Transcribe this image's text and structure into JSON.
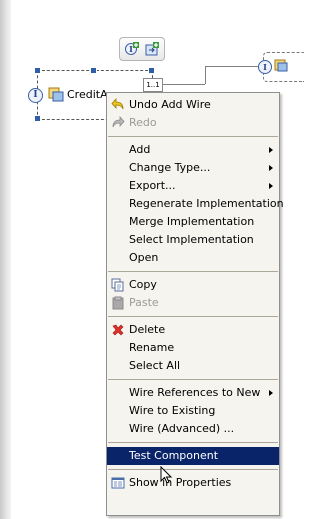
{
  "component": {
    "name": "CreditApproval",
    "label": "CreditAp",
    "interface_symbol": "I",
    "multiplicity": "1..1"
  },
  "target": {
    "interface_symbol": "I"
  },
  "menu": {
    "undo": "Undo Add Wire",
    "redo": "Redo",
    "add": "Add",
    "change_type": "Change Type...",
    "export": "Export...",
    "regenerate": "Regenerate Implementation",
    "merge": "Merge Implementation",
    "select_impl": "Select Implementation",
    "open": "Open",
    "copy": "Copy",
    "paste": "Paste",
    "delete": "Delete",
    "rename": "Rename",
    "select_all": "Select All",
    "wire_refs": "Wire References to New",
    "wire_existing": "Wire to Existing",
    "wire_advanced": "Wire (Advanced) ...",
    "test_component": "Test Component",
    "show_props": "Show in Properties"
  },
  "colors": {
    "highlight": "#0a246a",
    "menu_bg": "#f5f4ef",
    "disabled": "#9a9a9a"
  }
}
